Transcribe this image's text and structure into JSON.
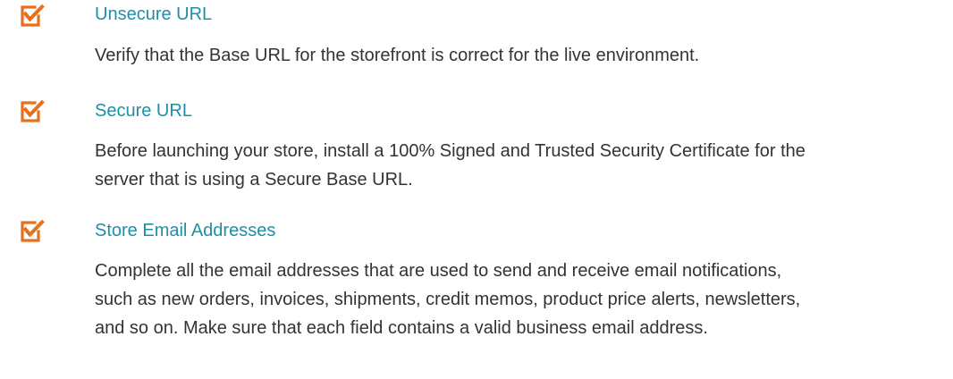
{
  "accent_color": "#e5701e",
  "title_color": "#1e8fa8",
  "text_color": "#333333",
  "icon": "checked-box-icon",
  "items": [
    {
      "title": "Unsecure URL",
      "body": "Verify that the Base URL for the storefront is correct for the live environment."
    },
    {
      "title": "Secure URL",
      "body": "Before launching your store, install a 100% Signed and Trusted Security Certificate for the server that is using a Secure Base URL."
    },
    {
      "title": "Store Email Addresses",
      "body": "Complete all the email addresses that are used to send and receive email notifications, such as new orders, invoices, shipments, credit memos, product price alerts, newsletters, and so on. Make sure that each field contains a valid business email address."
    }
  ]
}
